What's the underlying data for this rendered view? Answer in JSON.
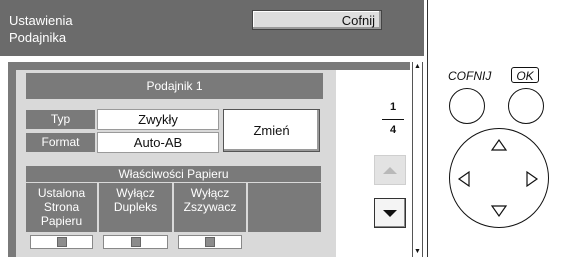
{
  "header": {
    "title": "Ustawienia\nPodajnika",
    "back_button": "Cofnij"
  },
  "tray": {
    "title": "Podajnik 1",
    "type_label": "Typ",
    "type_value": "Zwykły",
    "format_label": "Format",
    "format_value": "Auto-AB",
    "change_button": "Zmień"
  },
  "properties": {
    "title": "Właściwości Papieru",
    "items": [
      {
        "label": "Ustalona\nStrona\nPapieru"
      },
      {
        "label": "Wyłącz\nDupleks"
      },
      {
        "label": "Wyłącz\nZszywacz"
      }
    ]
  },
  "pager": {
    "current": "1",
    "total": "4"
  },
  "keys": {
    "back_label": "COFNIJ",
    "ok_label": "OK"
  },
  "icons": {
    "scroll_up": "triangle-up-icon",
    "scroll_down": "triangle-down-icon",
    "dpad_up": "triangle-up-outline-icon",
    "dpad_down": "triangle-down-outline-icon",
    "dpad_left": "triangle-left-outline-icon",
    "dpad_right": "triangle-right-outline-icon"
  }
}
